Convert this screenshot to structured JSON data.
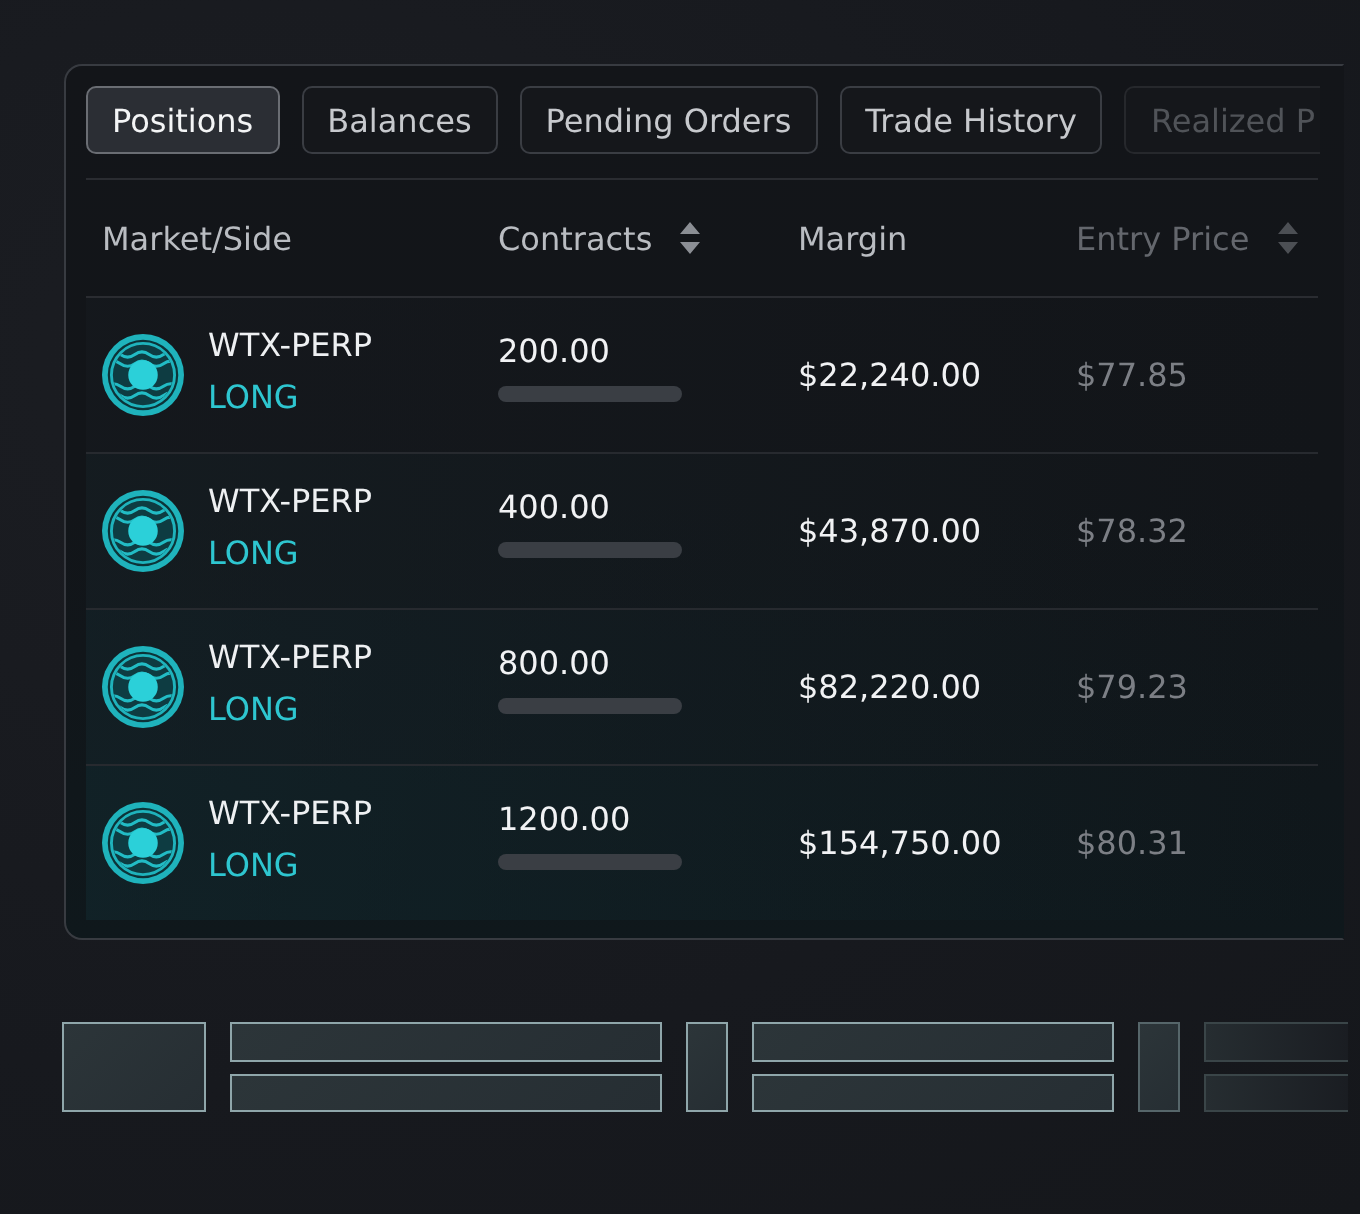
{
  "tabs": [
    {
      "label": "Positions",
      "selected": true
    },
    {
      "label": "Balances",
      "selected": false
    },
    {
      "label": "Pending Orders",
      "selected": false
    },
    {
      "label": "Trade History",
      "selected": false
    },
    {
      "label": "Realized P",
      "selected": false
    }
  ],
  "table": {
    "columns": [
      {
        "label": "Market/Side",
        "sortable": false
      },
      {
        "label": "Contracts",
        "sortable": true
      },
      {
        "label": "Margin",
        "sortable": false
      },
      {
        "label": "Entry Price",
        "sortable": true
      }
    ],
    "rows": [
      {
        "market": "WTX-PERP",
        "side": "LONG",
        "contracts": "200.00",
        "margin": "$22,240.00",
        "entry_price": "$77.85"
      },
      {
        "market": "WTX-PERP",
        "side": "LONG",
        "contracts": "400.00",
        "margin": "$43,870.00",
        "entry_price": "$78.32"
      },
      {
        "market": "WTX-PERP",
        "side": "LONG",
        "contracts": "800.00",
        "margin": "$82,220.00",
        "entry_price": "$79.23"
      },
      {
        "market": "WTX-PERP",
        "side": "LONG",
        "contracts": "1200.00",
        "margin": "$154,750.00",
        "entry_price": "$80.31"
      }
    ]
  }
}
